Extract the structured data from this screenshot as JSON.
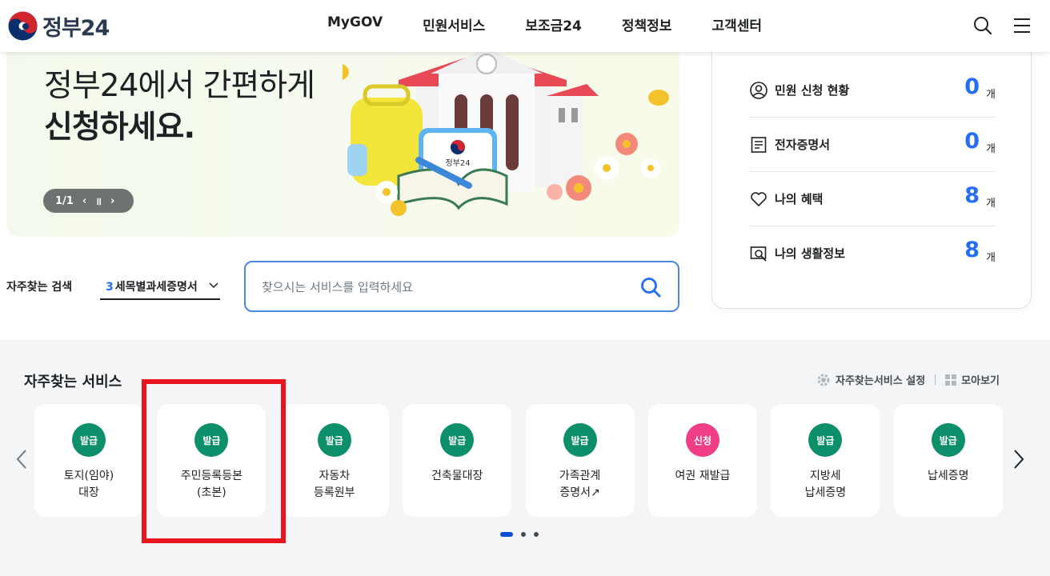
{
  "header": {
    "logo_text": "정부24",
    "nav": [
      "MyGOV",
      "민원서비스",
      "보조금24",
      "정책정보",
      "고객센터"
    ],
    "search_icon": "search-icon",
    "menu_icon": "hamburger-menu-icon"
  },
  "banner": {
    "line1": "정부24에서 간편하게",
    "line2": "신청하세요.",
    "page_indicator": "1/1",
    "prev_label": "‹",
    "pause_label": "॥",
    "next_label": "›",
    "art_text": "정부24"
  },
  "search": {
    "frequent_label": "자주찾는 검색",
    "select_rank": "3",
    "select_value": "세목별과세증명서",
    "placeholder": "찾으시는 서비스를 입력하세요"
  },
  "status": [
    {
      "label": "민원 신청 현황",
      "count": "0",
      "unit": "개",
      "icon": "person-circle-icon"
    },
    {
      "label": "전자증명서",
      "count": "0",
      "unit": "개",
      "icon": "document-icon"
    },
    {
      "label": "나의 혜택",
      "count": "8",
      "unit": "개",
      "icon": "heart-icon"
    },
    {
      "label": "나의 생활정보",
      "count": "8",
      "unit": "개",
      "icon": "search-screen-icon"
    }
  ],
  "services": {
    "title": "자주찾는 서비스",
    "settings_label": "자주찾는서비스 설정",
    "view_all_label": "모아보기",
    "items": [
      {
        "badge": "발급",
        "name": "토지(임야)\n대장",
        "badge_color": "#0c8f6a"
      },
      {
        "badge": "발급",
        "name": "주민등록등본\n(초본)",
        "badge_color": "#0c8f6a"
      },
      {
        "badge": "발급",
        "name": "자동차\n등록원부",
        "badge_color": "#0c8f6a"
      },
      {
        "badge": "발급",
        "name": "건축물대장",
        "badge_color": "#0c8f6a"
      },
      {
        "badge": "발급",
        "name": "가족관계\n증명서↗",
        "badge_color": "#0c8f6a"
      },
      {
        "badge": "신청",
        "name": "여권 재발급",
        "badge_color": "#ef3d86"
      },
      {
        "badge": "발급",
        "name": "지방세\n납세증명",
        "badge_color": "#0c8f6a"
      },
      {
        "badge": "발급",
        "name": "납세증명",
        "badge_color": "#0c8f6a"
      }
    ]
  },
  "colors": {
    "accent_blue": "#256ef4",
    "badge_green": "#0c8f6a",
    "badge_pink": "#ef3d86",
    "highlight_red": "#e8141e"
  }
}
